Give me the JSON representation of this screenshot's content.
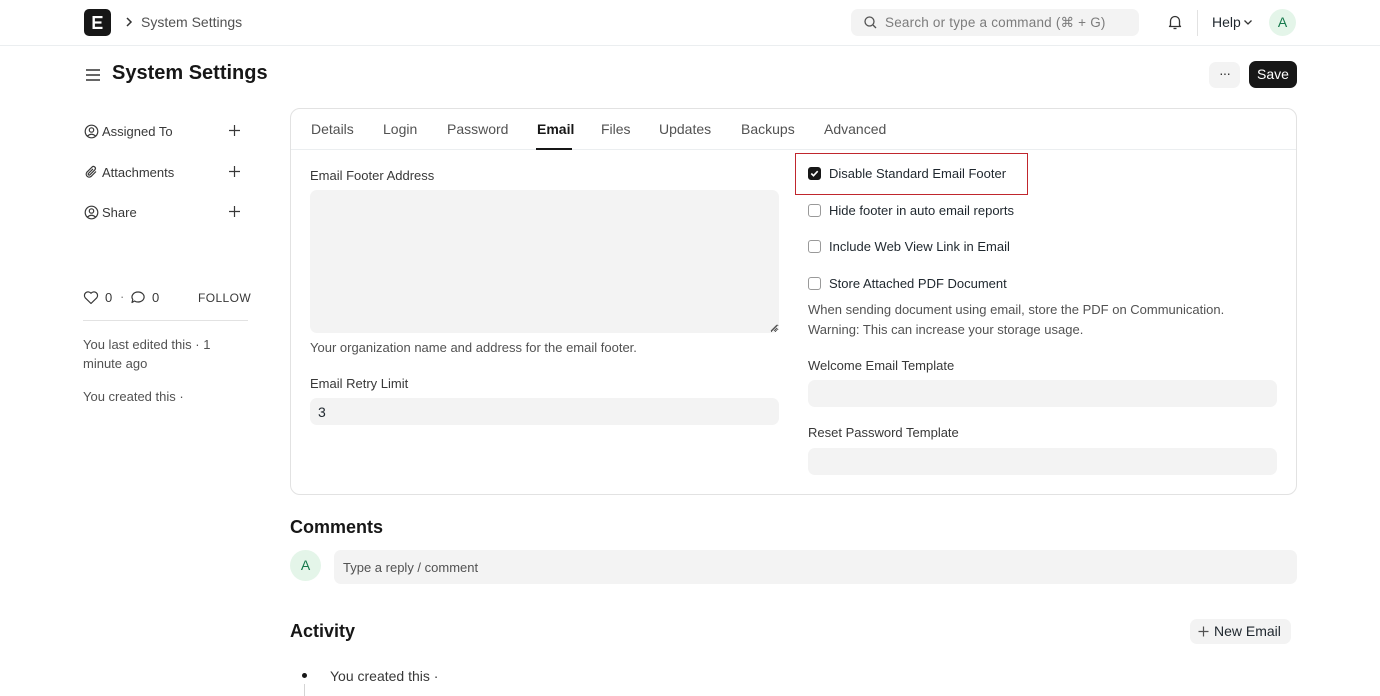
{
  "navbar": {
    "breadcrumb": "System Settings",
    "search_placeholder": "Search or type a command (⌘ + G)",
    "help_label": "Help",
    "avatar_initial": "A"
  },
  "page": {
    "title": "System Settings",
    "more_label": "···",
    "save_label": "Save"
  },
  "sidebar": {
    "items": [
      {
        "label": "Assigned To",
        "icon": "user-circle-icon"
      },
      {
        "label": "Attachments",
        "icon": "paperclip-icon"
      },
      {
        "label": "Share",
        "icon": "share-user-icon"
      }
    ],
    "like_count": "0",
    "comment_count": "0",
    "separator": "·",
    "follow_label": "FOLLOW",
    "last_edited": "You last edited this · 1 minute ago",
    "created": "You created this ·"
  },
  "tabs": [
    {
      "label": "Details",
      "active": false
    },
    {
      "label": "Login",
      "active": false
    },
    {
      "label": "Password",
      "active": false
    },
    {
      "label": "Email",
      "active": true
    },
    {
      "label": "Files",
      "active": false
    },
    {
      "label": "Updates",
      "active": false
    },
    {
      "label": "Backups",
      "active": false
    },
    {
      "label": "Advanced",
      "active": false
    }
  ],
  "form": {
    "footer_address_label": "Email Footer Address",
    "footer_address_value": "",
    "footer_address_help": "Your organization name and address for the email footer.",
    "retry_limit_label": "Email Retry Limit",
    "retry_limit_value": "3",
    "checkboxes": [
      {
        "label": "Disable Standard Email Footer",
        "checked": true
      },
      {
        "label": "Hide footer in auto email reports",
        "checked": false
      },
      {
        "label": "Include Web View Link in Email",
        "checked": false
      },
      {
        "label": "Store Attached PDF Document",
        "checked": false
      }
    ],
    "pdf_help_line1": "When sending document using email, store the PDF on Communication.",
    "pdf_help_line2": "Warning: This can increase your storage usage.",
    "welcome_template_label": "Welcome Email Template",
    "welcome_template_value": "",
    "reset_template_label": "Reset Password Template",
    "reset_template_value": ""
  },
  "comments": {
    "title": "Comments",
    "avatar_initial": "A",
    "placeholder": "Type a reply / comment"
  },
  "activity": {
    "title": "Activity",
    "new_email_label": "New Email",
    "entries": [
      {
        "text": "You created this ·"
      }
    ]
  },
  "colors": {
    "accent_dark": "#171717",
    "highlight_border": "#c0262d",
    "avatar_bg": "#e4f5e9",
    "avatar_fg": "#16794c"
  }
}
